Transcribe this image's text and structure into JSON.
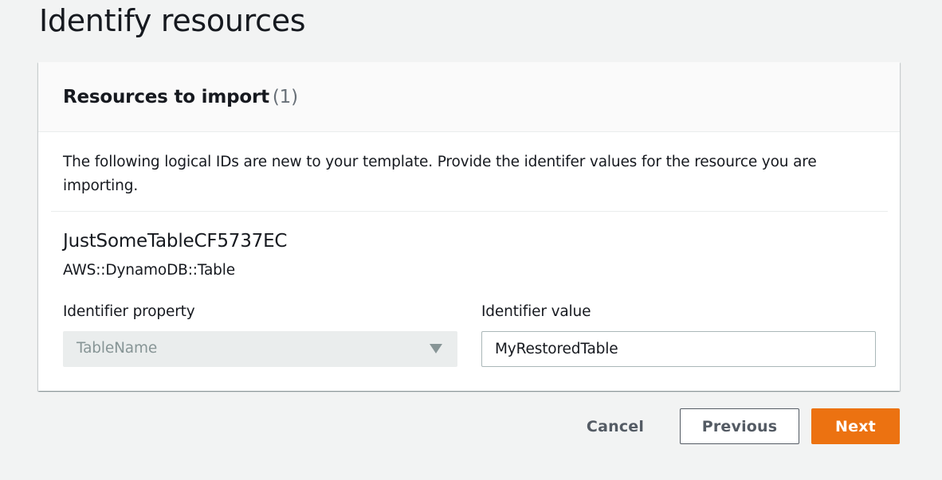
{
  "page": {
    "title": "Identify resources"
  },
  "panel": {
    "title": "Resources to import",
    "count": "(1)",
    "description": "The following logical IDs are new to your template. Provide the identifer values for the resource you are importing."
  },
  "resource": {
    "logical_id": "JustSomeTableCF5737EC",
    "type": "AWS::DynamoDB::Table",
    "identifier_property": {
      "label": "Identifier property",
      "selected": "TableName",
      "disabled": true
    },
    "identifier_value": {
      "label": "Identifier value",
      "value": "MyRestoredTable"
    }
  },
  "actions": {
    "cancel_label": "Cancel",
    "previous_label": "Previous",
    "next_label": "Next"
  },
  "colors": {
    "background": "#f2f3f3",
    "panel_header": "#fafafa",
    "primary_button": "#ec7211",
    "secondary_text": "#545b64",
    "disabled_field": "#eaeded"
  },
  "icons": {
    "select_caret": "caret-down-icon"
  }
}
